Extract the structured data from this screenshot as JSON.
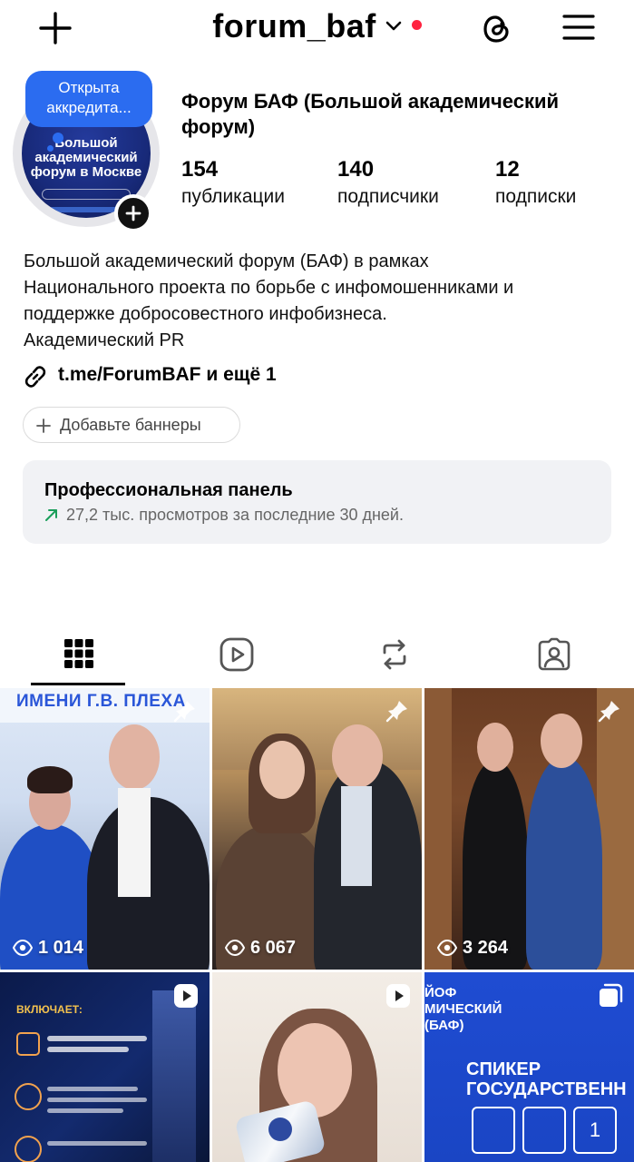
{
  "header": {
    "username": "forum_baf",
    "has_notification_dot": true,
    "notification_color": "#ff2340"
  },
  "profile": {
    "story_bubble": "Открыта аккредита...",
    "avatar_text": "Большой академический форум в Москве",
    "display_name": "Форум БАФ (Большой академический форум)",
    "stats": [
      {
        "number": "154",
        "label": "публикации"
      },
      {
        "number": "140",
        "label": "подписчики"
      },
      {
        "number": "12",
        "label": "подписки"
      }
    ],
    "bio_lines": [
      "Большой академический форум (БАФ) в рамках",
      "Национального проекта по борьбе с инфомошенниками и",
      "поддержке добросовестного инфобизнеса.",
      "Академический PR"
    ],
    "link_text": "t.me/ForumBAF и ещё 1",
    "add_banners": "Добавьте баннеры"
  },
  "pro_panel": {
    "title": "Профессиональная панель",
    "subtitle": "27,2 тыс. просмотров за последние 30 дней.",
    "accent_color": "#1a9e5a"
  },
  "tabs": [
    {
      "icon": "grid-icon",
      "active": true
    },
    {
      "icon": "reels-icon",
      "active": false
    },
    {
      "icon": "reposts-icon",
      "active": false
    },
    {
      "icon": "tagged-icon",
      "active": false
    }
  ],
  "posts": [
    {
      "views": "1 014",
      "pinned": true,
      "overlay_text": "ИМЕНИ Г.В. ПЛЕХА"
    },
    {
      "views": "6 067",
      "pinned": true
    },
    {
      "views": "3 264",
      "pinned": true
    },
    {
      "type": "reel",
      "overlay_text": "ВКЛЮЧАЕТ:"
    },
    {
      "type": "reel"
    },
    {
      "type": "carousel",
      "overlay_text": "СПИКЕР ГОСУДАРСТВЕНН",
      "overlay_text_top": "ЙОФ МИЧЕСКИЙ (БАФ)",
      "page_num": "1"
    }
  ]
}
